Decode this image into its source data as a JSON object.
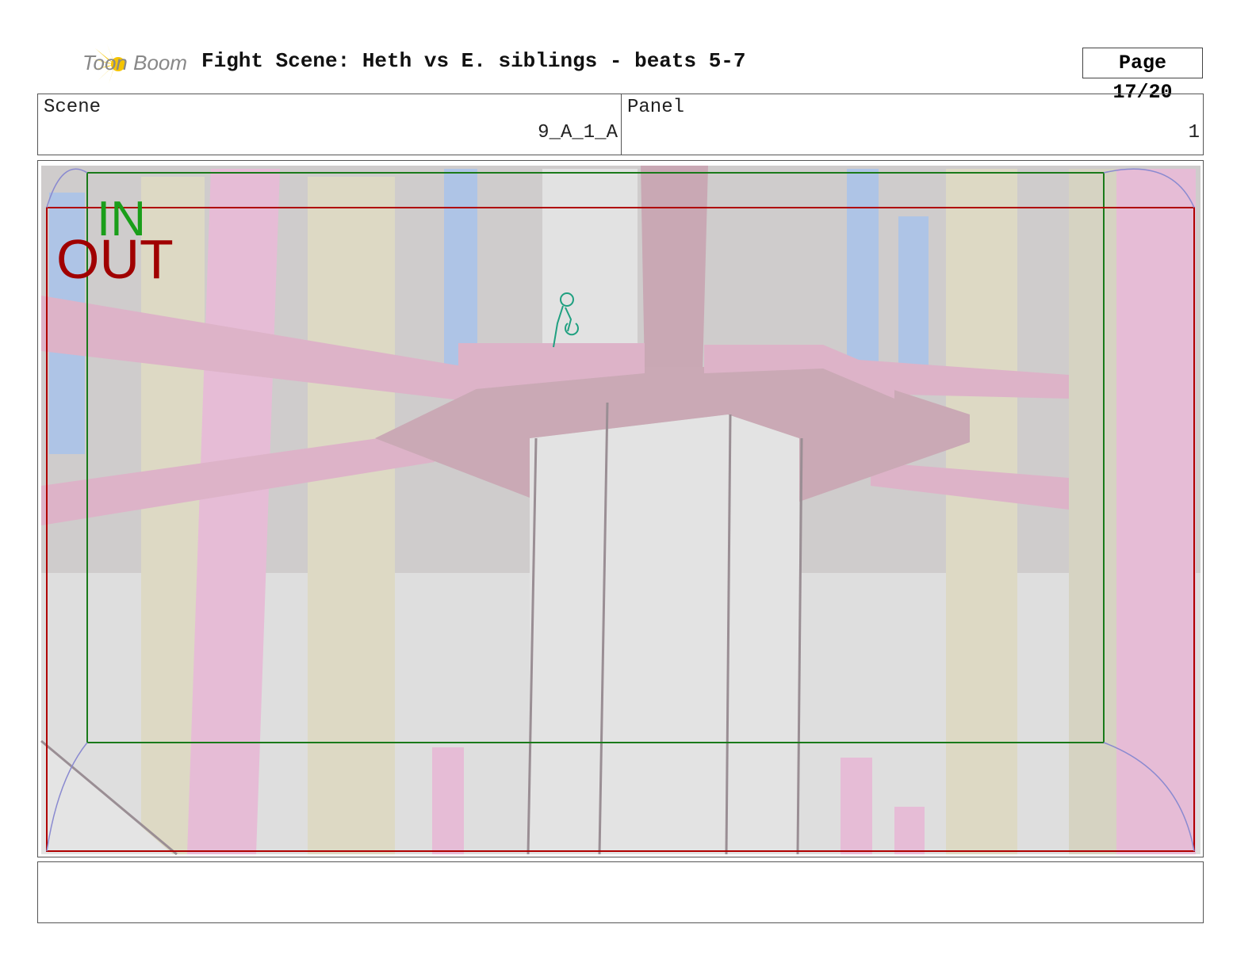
{
  "header": {
    "logo_text": "Toon Boom",
    "title": "Fight Scene: Heth vs E. siblings - beats 5-7",
    "page": "Page 17/20"
  },
  "info": {
    "scene_label": "Scene",
    "scene_value": "9_A_1_A",
    "panel_label": "Panel",
    "panel_value": "1"
  },
  "frame": {
    "in_label": "IN",
    "out_label": "OUT",
    "in_color": "#1a9e1a",
    "out_color": "#a00000"
  },
  "notes": {
    "text": ""
  }
}
